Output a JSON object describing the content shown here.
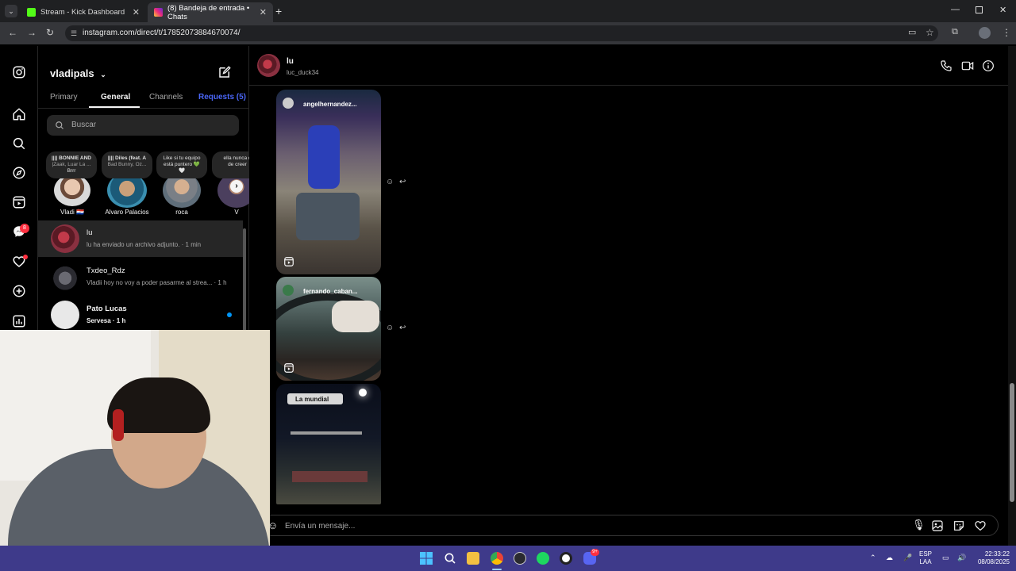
{
  "browser": {
    "tabs": [
      {
        "title": "Stream - Kick Dashboard",
        "active": false,
        "favicon_color": "#53fc18"
      },
      {
        "title": "(8) Bandeja de entrada • Chats",
        "active": true,
        "favicon_color": "#e1306c"
      }
    ],
    "url": "instagram.com/direct/t/17852073884670074/"
  },
  "rail": {
    "icons": [
      "instagram-logo-icon",
      "home-icon",
      "search-icon",
      "explore-icon",
      "reels-icon",
      "messenger-icon",
      "heart-icon",
      "create-icon",
      "dashboard-icon"
    ],
    "messenger_badge": "8"
  },
  "sidebar": {
    "username": "vladipals",
    "tabs": [
      {
        "label": "Primary",
        "active": false
      },
      {
        "label": "General",
        "active": true
      },
      {
        "label": "Channels",
        "active": false
      },
      {
        "label": "Requests (5)",
        "active": false
      }
    ],
    "search_placeholder": "Buscar",
    "notes": [
      {
        "line1": "|||| BONNIE AND",
        "line2": "|Zaak, Luar La ...",
        "line3": "Brrr",
        "name": "Vladi 🇵🇾"
      },
      {
        "line1": "|||| Diles (feat. A",
        "line2": "Bad Bunny, Oz...",
        "line3": "",
        "name": "Alvaro Palacios"
      },
      {
        "line1": "Like si tu equipo",
        "line2": "está puntero 💚",
        "line3": "🤍",
        "name": "roca"
      },
      {
        "line1": "ella nunca d",
        "line2": "de creer",
        "line3": "",
        "name": "V"
      }
    ],
    "conversations": [
      {
        "name": "lu",
        "preview": "lu ha enviado un archivo adjunto. · 1 min",
        "unread": false
      },
      {
        "name": "Txdeo_Rdz",
        "preview": "Vladii hoy no voy a poder pasarme al strea... · 1 h",
        "unread": false
      },
      {
        "name": "Pato Lucas",
        "preview": "Servesa · 1 h",
        "unread": true
      }
    ]
  },
  "chat": {
    "name": "lu",
    "handle": "luc_duck34",
    "media": [
      {
        "username": "angelhernandez..."
      },
      {
        "username": "fernando_caban..."
      },
      {
        "username": "La mundial"
      }
    ],
    "composer_placeholder": "Envía un mensaje..."
  },
  "taskbar": {
    "lang_top": "ESP",
    "lang_bottom": "LAA",
    "time": "22:33:22",
    "date": "08/08/2025",
    "discord_badge": "9+"
  },
  "colors": {
    "accent_blue": "#0095f6",
    "request_blue": "#4a66f7",
    "badge_red": "#ff3040"
  }
}
